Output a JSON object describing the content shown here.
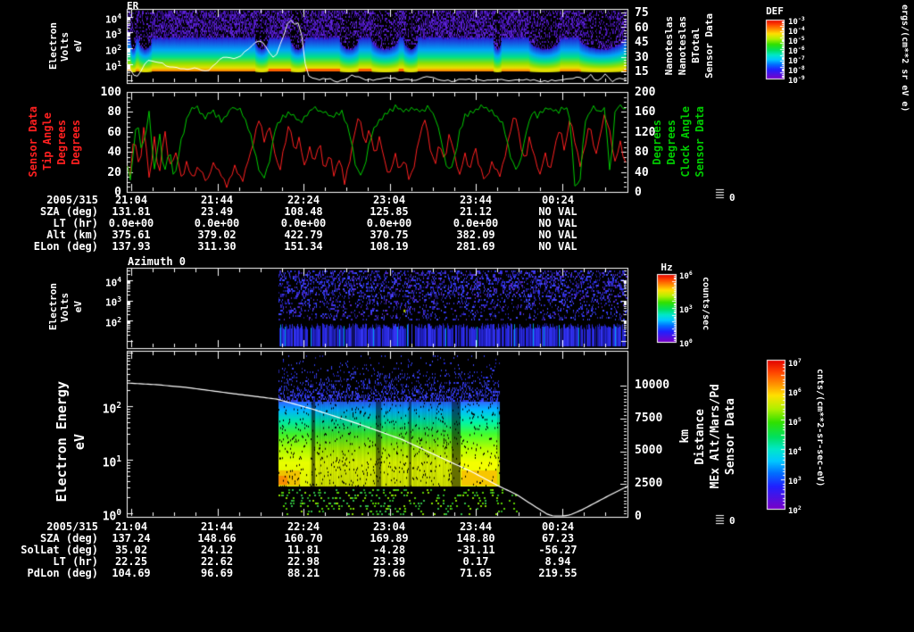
{
  "window": {
    "background": "#000000"
  },
  "panel1": {
    "title": "ER",
    "left_axis": {
      "lines": [
        "Electron Volts",
        "eV"
      ],
      "ticks": [
        {
          "b": "10",
          "e": "4"
        },
        {
          "b": "10",
          "e": "3"
        },
        {
          "b": "10",
          "e": "2"
        },
        {
          "b": "10",
          "e": "1"
        }
      ]
    },
    "right_axis": {
      "lines": [
        "Sensor Data",
        "BTotal",
        "Nanoteslas",
        "Nanoteslas"
      ],
      "ticks": [
        "75",
        "60",
        "45",
        "30",
        "15"
      ]
    },
    "colorbar": {
      "title": "DEF",
      "unit": "ergs/(cm**2 sr eV e)",
      "ticks": [
        {
          "b": "10",
          "e": "-3"
        },
        {
          "b": "10",
          "e": "-4"
        },
        {
          "b": "10",
          "e": "-5"
        },
        {
          "b": "10",
          "e": "-6"
        },
        {
          "b": "10",
          "e": "-7"
        },
        {
          "b": "10",
          "e": "-8"
        },
        {
          "b": "10",
          "e": "-9"
        }
      ]
    }
  },
  "panel2": {
    "left_axis": {
      "lines": [
        "Sensor Data",
        "Tip Angle",
        "Degrees",
        "Degrees"
      ],
      "color": "#ff2020",
      "ticks": [
        "100",
        "80",
        "60",
        "40",
        "20",
        "0"
      ]
    },
    "right_axis": {
      "lines": [
        "Sensor Data",
        "Clock Angle",
        "Degrees",
        "Degrees"
      ],
      "color": "#00cc00",
      "ticks": [
        "200",
        "160",
        "120",
        "80",
        "40",
        "0"
      ]
    },
    "edge_tick_label": "0"
  },
  "table1": {
    "rows": [
      {
        "label": "2005/315",
        "values": [
          "21:04",
          "21:44",
          "22:24",
          "23:04",
          "23:44",
          "00:24"
        ]
      },
      {
        "label": "SZA (deg)",
        "values": [
          "131.81",
          "23.49",
          "108.48",
          "125.85",
          "21.12",
          "NO VAL"
        ]
      },
      {
        "label": "LT (hr)",
        "values": [
          "0.0e+00",
          "0.0e+00",
          "0.0e+00",
          "0.0e+00",
          "0.0e+00",
          "NO VAL"
        ]
      },
      {
        "label": "Alt (km)",
        "values": [
          "375.61",
          "379.02",
          "422.79",
          "370.75",
          "382.09",
          "NO VAL"
        ]
      },
      {
        "label": "ELon (deg)",
        "values": [
          "137.93",
          "311.30",
          "151.34",
          "108.19",
          "281.69",
          "NO VAL"
        ]
      }
    ]
  },
  "panel3": {
    "title": "Azimuth 0",
    "left_axis": {
      "lines": [
        "Electron Volts",
        "eV"
      ],
      "ticks": [
        {
          "b": "10",
          "e": "4"
        },
        {
          "b": "10",
          "e": "3"
        },
        {
          "b": "10",
          "e": "2"
        }
      ]
    },
    "colorbar": {
      "title": "Hz",
      "unit": "counts/sec",
      "ticks": [
        {
          "b": "10",
          "e": "6"
        },
        {
          "b": "10",
          "e": "3"
        },
        {
          "b": "10",
          "e": "0"
        }
      ]
    }
  },
  "panel4": {
    "left_axis": {
      "lines": [
        "Electron Energy",
        "eV"
      ],
      "ticks": [
        {
          "b": "10",
          "e": "2"
        },
        {
          "b": "10",
          "e": "1"
        },
        {
          "b": "10",
          "e": "0"
        }
      ]
    },
    "right_axis": {
      "lines": [
        "Sensor Data",
        "MEx Alt/Mars/Pd",
        "Distance",
        "km"
      ],
      "ticks": [
        "10000",
        "7500",
        "5000",
        "2500",
        "0"
      ]
    },
    "colorbar": {
      "unit": "cnts/(cm**2-sr-sec-eV)",
      "ticks": [
        {
          "b": "10",
          "e": "7"
        },
        {
          "b": "10",
          "e": "6"
        },
        {
          "b": "10",
          "e": "5"
        },
        {
          "b": "10",
          "e": "4"
        },
        {
          "b": "10",
          "e": "3"
        },
        {
          "b": "10",
          "e": "2"
        }
      ]
    },
    "edge_tick_label": "0"
  },
  "table2": {
    "rows": [
      {
        "label": "2005/315",
        "values": [
          "21:04",
          "21:44",
          "22:24",
          "23:04",
          "23:44",
          "00:24"
        ]
      },
      {
        "label": "SZA (deg)",
        "values": [
          "137.24",
          "148.66",
          "160.70",
          "169.89",
          "148.80",
          "67.23"
        ]
      },
      {
        "label": "SolLat (deg)",
        "values": [
          "35.02",
          "24.12",
          "11.81",
          "-4.28",
          "-31.11",
          "-56.27"
        ]
      },
      {
        "label": "LT (hr)",
        "values": [
          "22.25",
          "22.62",
          "22.98",
          "23.39",
          "0.17",
          "8.94"
        ]
      },
      {
        "label": "PdLon (deg)",
        "values": [
          "104.69",
          "96.69",
          "88.21",
          "79.66",
          "71.65",
          "219.55"
        ]
      }
    ]
  },
  "chart_data": [
    {
      "type": "heatmap",
      "name": "er-electron-spectrogram",
      "title": "ER",
      "x_major_ticks": [
        "21:04",
        "21:44",
        "22:24",
        "23:04",
        "23:44",
        "00:24"
      ],
      "y_scale": "log",
      "y_unit": "eV",
      "y_range": [
        5,
        30000
      ],
      "z_unit": "ergs/(cm**2 sr eV e)",
      "z_range_exponents": [
        -9,
        -3
      ],
      "gaps": [
        [
          0.007,
          0.018
        ],
        [
          0.023,
          0.05
        ],
        [
          0.255,
          0.282
        ],
        [
          0.326,
          0.356
        ],
        [
          0.424,
          0.463
        ],
        [
          0.487,
          0.543
        ],
        [
          0.552,
          0.581
        ],
        [
          0.731,
          0.748
        ],
        [
          0.802,
          0.866
        ],
        [
          0.902,
          0.994
        ]
      ],
      "overlay_line": {
        "name": "BTotal",
        "unit": "nT",
        "axis_range": [
          15,
          75
        ],
        "x_frac": [
          0,
          0.018,
          0.035,
          0.044,
          0.053,
          0.07,
          0.094,
          0.12,
          0.142,
          0.16,
          0.178,
          0.195,
          0.213,
          0.231,
          0.249,
          0.266,
          0.284,
          0.296,
          0.314,
          0.325,
          0.332,
          0.341,
          0.35,
          0.355,
          0.364,
          0.378,
          0.403,
          0.426,
          0.45,
          0.48,
          0.52,
          0.55,
          0.58,
          0.6,
          0.63,
          0.65,
          0.68,
          0.71,
          0.74,
          0.77,
          0.8,
          0.83,
          0.86,
          0.885,
          0.9,
          0.912,
          0.92,
          0.927,
          0.94,
          0.95,
          0.957,
          0.97,
          0.985,
          1
        ],
        "values": [
          23,
          7,
          21,
          27,
          24,
          23,
          19,
          17,
          18,
          14.5,
          23,
          30,
          28,
          32,
          41,
          47,
          35,
          27,
          53,
          71,
          62,
          67,
          51,
          26,
          9,
          6.5,
          7.5,
          4.5,
          11,
          6,
          9,
          7,
          6,
          10,
          6,
          5,
          7,
          5.5,
          6,
          6.5,
          6,
          5,
          6,
          8,
          10,
          5,
          8.5,
          11,
          5,
          9,
          12,
          5,
          8,
          5
        ]
      }
    },
    {
      "type": "line",
      "name": "angle-lines",
      "x_major_ticks": [
        "21:04",
        "21:44",
        "22:24",
        "23:04",
        "23:44",
        "00:24"
      ],
      "series": [
        {
          "name": "Tip Angle",
          "unit": "Degrees",
          "color": "#ff2020",
          "axis_range": [
            0,
            100
          ],
          "x_frac": [
            0,
            0.005,
            0.015,
            0.025,
            0.035,
            0.045,
            0.055,
            0.065,
            0.075,
            0.085,
            0.1,
            0.11,
            0.12,
            0.13,
            0.145,
            0.16,
            0.175,
            0.19,
            0.2,
            0.215,
            0.23,
            0.245,
            0.255,
            0.265,
            0.275,
            0.285,
            0.295,
            0.305,
            0.315,
            0.325,
            0.335,
            0.345,
            0.355,
            0.365,
            0.375,
            0.385,
            0.395,
            0.405,
            0.415,
            0.425,
            0.435,
            0.445,
            0.455,
            0.465,
            0.475,
            0.485,
            0.495,
            0.505,
            0.515,
            0.525,
            0.535,
            0.545,
            0.555,
            0.565,
            0.575,
            0.585,
            0.595,
            0.605,
            0.615,
            0.625,
            0.635,
            0.645,
            0.655,
            0.665,
            0.675,
            0.685,
            0.695,
            0.705,
            0.715,
            0.73,
            0.745,
            0.755,
            0.765,
            0.775,
            0.785,
            0.795,
            0.805,
            0.815,
            0.825,
            0.835,
            0.845,
            0.855,
            0.865,
            0.875,
            0.885,
            0.895,
            0.905,
            0.915,
            0.925,
            0.935,
            0.945,
            0.955,
            0.965,
            0.975,
            0.985,
            1
          ],
          "values": [
            35,
            5,
            60,
            20,
            70,
            10,
            55,
            15,
            65,
            25,
            40,
            10,
            30,
            15,
            25,
            10,
            30,
            15,
            5,
            25,
            10,
            35,
            55,
            75,
            50,
            65,
            40,
            20,
            45,
            70,
            40,
            55,
            25,
            45,
            30,
            50,
            20,
            40,
            15,
            35,
            10,
            30,
            60,
            80,
            45,
            65,
            35,
            55,
            30,
            15,
            40,
            20,
            35,
            10,
            30,
            55,
            75,
            45,
            25,
            50,
            30,
            60,
            35,
            15,
            40,
            20,
            45,
            25,
            10,
            30,
            15,
            35,
            60,
            80,
            50,
            30,
            55,
            35,
            15,
            40,
            20,
            45,
            65,
            40,
            75,
            50,
            25,
            45,
            70,
            35,
            55,
            80,
            60,
            30,
            50,
            20
          ]
        },
        {
          "name": "Clock Angle",
          "unit": "Degrees",
          "color": "#00cc00",
          "axis_range": [
            0,
            200
          ],
          "x_frac": [
            0,
            0.008,
            0.02,
            0.03,
            0.045,
            0.055,
            0.065,
            0.075,
            0.085,
            0.095,
            0.11,
            0.125,
            0.14,
            0.155,
            0.17,
            0.19,
            0.21,
            0.23,
            0.245,
            0.255,
            0.265,
            0.275,
            0.285,
            0.295,
            0.31,
            0.325,
            0.345,
            0.36,
            0.375,
            0.39,
            0.41,
            0.43,
            0.445,
            0.455,
            0.465,
            0.475,
            0.485,
            0.5,
            0.52,
            0.54,
            0.555,
            0.57,
            0.59,
            0.605,
            0.615,
            0.625,
            0.635,
            0.645,
            0.655,
            0.665,
            0.675,
            0.69,
            0.71,
            0.73,
            0.75,
            0.76,
            0.77,
            0.78,
            0.79,
            0.8,
            0.81,
            0.82,
            0.84,
            0.86,
            0.875,
            0.885,
            0.895,
            0.905,
            0.915,
            0.925,
            0.935,
            0.945,
            0.955,
            0.965,
            0.975,
            0.985,
            1
          ],
          "values": [
            60,
            20,
            150,
            80,
            160,
            40,
            120,
            30,
            90,
            20,
            110,
            160,
            170,
            150,
            165,
            140,
            170,
            160,
            120,
            80,
            40,
            30,
            60,
            120,
            150,
            160,
            140,
            155,
            170,
            160,
            150,
            160,
            120,
            60,
            30,
            50,
            100,
            140,
            160,
            170,
            160,
            170,
            160,
            170,
            150,
            120,
            60,
            40,
            70,
            120,
            150,
            160,
            170,
            160,
            140,
            100,
            60,
            40,
            80,
            130,
            160,
            150,
            170,
            160,
            170,
            150,
            10,
            20,
            140,
            160,
            170,
            160,
            170,
            30,
            160,
            175,
            160
          ]
        }
      ]
    },
    {
      "type": "heatmap",
      "name": "azimuth-0-spectrogram",
      "title": "Azimuth 0",
      "y_scale": "log",
      "y_unit": "eV",
      "z_unit": "counts/sec",
      "z_range_exponents": [
        0,
        6
      ],
      "data_start_frac": 0.303,
      "bright_dot_frac": [
        0.553,
        0.52
      ]
    },
    {
      "type": "heatmap",
      "name": "electron-energy-spectrogram",
      "y_scale": "log",
      "y_unit": "eV",
      "z_unit": "cnts/(cm**2-sr-sec-eV)",
      "z_range_exponents": [
        2,
        7
      ],
      "block_x_frac": [
        0.302,
        0.745
      ],
      "overlay_line": {
        "name": "MEx Alt/Mars/Pd Distance",
        "unit": "km",
        "axis_range": [
          0,
          10000
        ],
        "x_frac": [
          0,
          0.06,
          0.12,
          0.2,
          0.3,
          0.37,
          0.46,
          0.55,
          0.635,
          0.69,
          0.74,
          0.778,
          0.814,
          0.84,
          0.858,
          0.885,
          0.91,
          0.937,
          0.964,
          0.982,
          1
        ],
        "values": [
          10200,
          10070,
          9860,
          9450,
          8970,
          8220,
          7120,
          5890,
          4380,
          3420,
          2400,
          1710,
          820,
          200,
          0,
          140,
          550,
          1100,
          1640,
          1990,
          2330
        ]
      }
    }
  ]
}
